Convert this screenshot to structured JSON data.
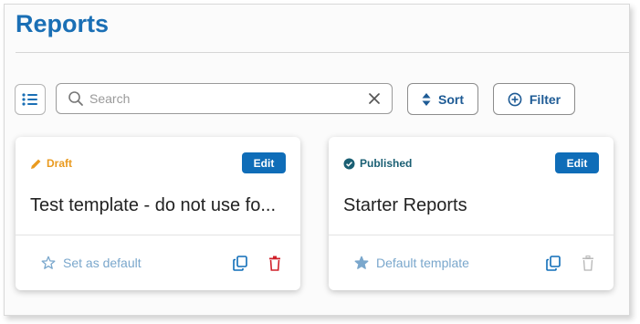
{
  "page": {
    "title": "Reports"
  },
  "toolbar": {
    "list_view_icon": "list-icon",
    "search_placeholder": "Search",
    "search_value": "",
    "sort_label": "Sort",
    "filter_label": "Filter"
  },
  "cards": [
    {
      "status": "Draft",
      "status_color": "#e99a1f",
      "edit_label": "Edit",
      "title": "Test template - do not use fo...",
      "default_label": "Set as default",
      "is_default": false
    },
    {
      "status": "Published",
      "status_color": "#1a5f73",
      "edit_label": "Edit",
      "title": "Starter Reports",
      "default_label": "Default template",
      "is_default": true
    }
  ],
  "colors": {
    "accent": "#1a6fb5",
    "button": "#0f6db8",
    "delete": "#d0202a"
  }
}
